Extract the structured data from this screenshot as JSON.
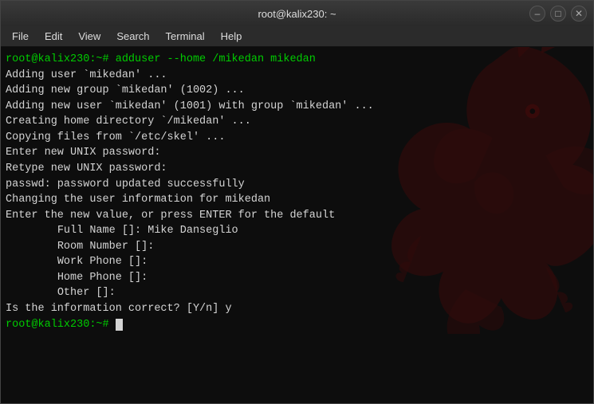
{
  "titleBar": {
    "title": "root@kalix230: ~"
  },
  "windowControls": {
    "minimize": "–",
    "maximize": "□",
    "close": "✕"
  },
  "menuBar": {
    "items": [
      "File",
      "Edit",
      "View",
      "Search",
      "Terminal",
      "Help"
    ]
  },
  "terminal": {
    "lines": [
      {
        "type": "green",
        "text": "root@kalix230:~# adduser --home /mikedan mikedan"
      },
      {
        "type": "white",
        "text": "Adding user `mikedan' ..."
      },
      {
        "type": "white",
        "text": "Adding new group `mikedan' (1002) ..."
      },
      {
        "type": "white",
        "text": "Adding new user `mikedan' (1001) with group `mikedan' ..."
      },
      {
        "type": "white",
        "text": "Creating home directory `/mikedan' ..."
      },
      {
        "type": "white",
        "text": "Copying files from `/etc/skel' ..."
      },
      {
        "type": "white",
        "text": "Enter new UNIX password:"
      },
      {
        "type": "white",
        "text": "Retype new UNIX password:"
      },
      {
        "type": "white",
        "text": "passwd: password updated successfully"
      },
      {
        "type": "white",
        "text": "Changing the user information for mikedan"
      },
      {
        "type": "white",
        "text": "Enter the new value, or press ENTER for the default"
      },
      {
        "type": "white",
        "text": "\tFull Name []: Mike Danseglio"
      },
      {
        "type": "white",
        "text": "\tRoom Number []:"
      },
      {
        "type": "white",
        "text": "\tWork Phone []:"
      },
      {
        "type": "white",
        "text": "\tHome Phone []:"
      },
      {
        "type": "white",
        "text": "\tOther []:"
      },
      {
        "type": "white",
        "text": "Is the information correct? [Y/n] y"
      },
      {
        "type": "green",
        "text": "root@kalix230:~# "
      }
    ],
    "cursor": true
  }
}
